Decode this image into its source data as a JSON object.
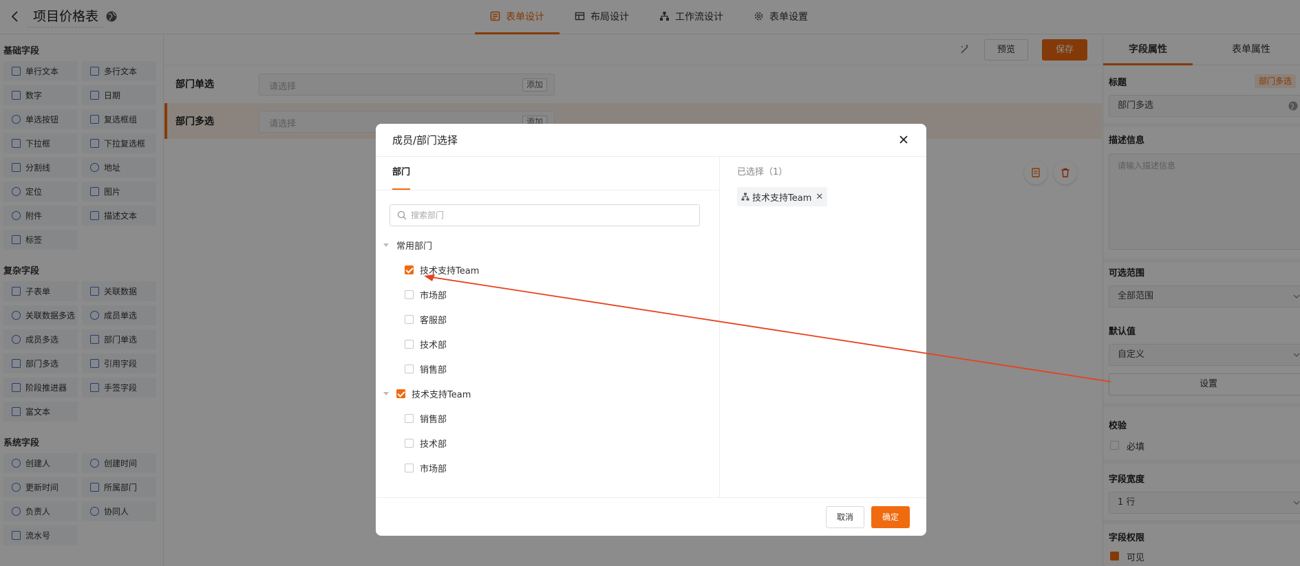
{
  "header": {
    "title": "项目价格表",
    "tabs": [
      {
        "label": "表单设计",
        "icon": "form-icon"
      },
      {
        "label": "布局设计",
        "icon": "layout-icon"
      },
      {
        "label": "工作流设计",
        "icon": "workflow-icon"
      },
      {
        "label": "表单设置",
        "icon": "gear-icon"
      }
    ]
  },
  "left_panel": {
    "groups": [
      {
        "title": "基础字段",
        "items": [
          "单行文本",
          "多行文本",
          "数字",
          "日期",
          "单选按钮",
          "复选框组",
          "下拉框",
          "下拉复选框",
          "分割线",
          "地址",
          "定位",
          "图片",
          "附件",
          "描述文本",
          "标签"
        ]
      },
      {
        "title": "复杂字段",
        "items": [
          "子表单",
          "关联数据",
          "关联数据多选",
          "成员单选",
          "成员多选",
          "部门单选",
          "部门多选",
          "引用字段",
          "阶段推进器",
          "手签字段",
          "富文本"
        ]
      },
      {
        "title": "系统字段",
        "items": [
          "创建人",
          "创建时间",
          "更新时间",
          "所属部门",
          "负责人",
          "协同人",
          "流水号"
        ]
      }
    ]
  },
  "canvas": {
    "preview_label": "预览",
    "save_label": "保存",
    "rows": [
      {
        "label": "部门单选",
        "placeholder": "请选择",
        "add_label": "添加"
      },
      {
        "label": "部门多选",
        "placeholder": "请选择",
        "add_label": "添加"
      }
    ]
  },
  "right_panel": {
    "tabs": [
      "字段属性",
      "表单属性"
    ],
    "title_label": "标题",
    "type_badge": "部门多选",
    "title_value": "部门多选",
    "desc_label": "描述信息",
    "desc_placeholder": "请输入描述信息",
    "range_label": "可选范围",
    "range_value": "全部范围",
    "default_label": "默认值",
    "default_value": "自定义",
    "set_label": "设置",
    "validate_label": "校验",
    "required_label": "必填",
    "width_label": "字段宽度",
    "width_value": "1 行",
    "perm_label": "字段权限",
    "visible_label": "可见"
  },
  "modal": {
    "title": "成员/部门选择",
    "tab": "部门",
    "search_placeholder": "搜索部门",
    "tree": [
      {
        "label": "常用部门",
        "level": 0,
        "checkbox": false,
        "checked": false,
        "expanded": true
      },
      {
        "label": "技术支持Team",
        "level": 1,
        "checkbox": true,
        "checked": true
      },
      {
        "label": "市场部",
        "level": 1,
        "checkbox": true,
        "checked": false
      },
      {
        "label": "客服部",
        "level": 1,
        "checkbox": true,
        "checked": false
      },
      {
        "label": "技术部",
        "level": 1,
        "checkbox": true,
        "checked": false
      },
      {
        "label": "销售部",
        "level": 1,
        "checkbox": true,
        "checked": false
      },
      {
        "label": "技术支持Team",
        "level": 0,
        "checkbox": true,
        "checked": true,
        "expanded": true
      },
      {
        "label": "销售部",
        "level": 1,
        "checkbox": true,
        "checked": false
      },
      {
        "label": "技术部",
        "level": 1,
        "checkbox": true,
        "checked": false
      },
      {
        "label": "市场部",
        "level": 1,
        "checkbox": true,
        "checked": false
      }
    ],
    "selected_title": "已选择（1）",
    "selected_tags": [
      "技术支持Team"
    ],
    "cancel_label": "取消",
    "ok_label": "确定"
  },
  "colors": {
    "accent": "#f06a0f",
    "annotation_arrow": "#e8401c"
  }
}
